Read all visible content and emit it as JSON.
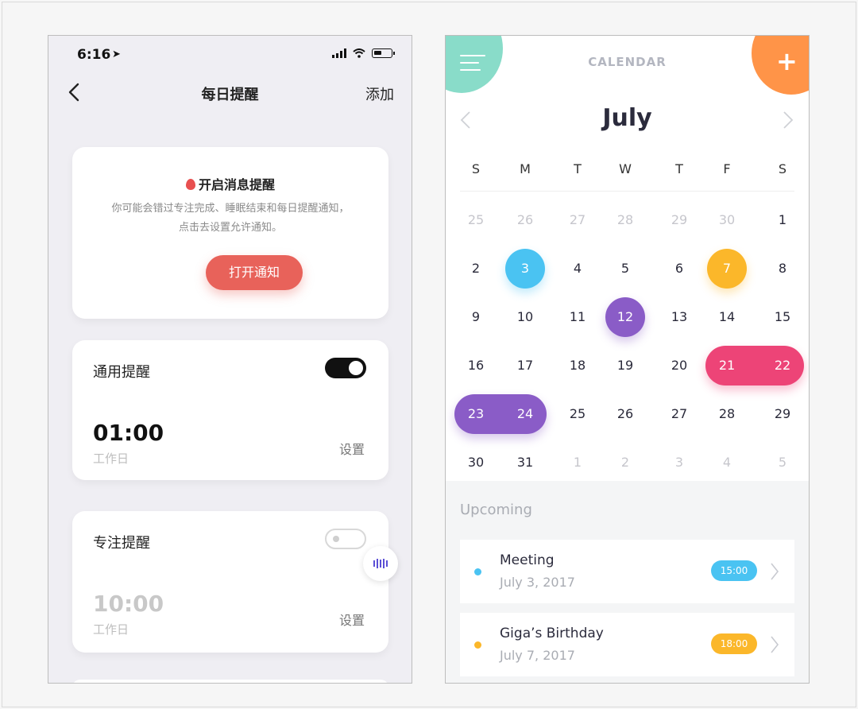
{
  "left_app": {
    "status": {
      "time": "6:16",
      "location_glyph": "➤"
    },
    "nav": {
      "title": "每日提醒",
      "action": "添加"
    },
    "notify_card": {
      "title": "开启消息提醒",
      "desc_line1": "你可能会错过专注完成、睡眠结束和每日提醒通知，",
      "desc_line2": "点击去设置允许通知。",
      "button": "打开通知"
    },
    "general_reminder": {
      "label": "通用提醒",
      "enabled": true,
      "time": "01:00",
      "days": "工作日",
      "settings": "设置"
    },
    "focus_reminder": {
      "label": "专注提醒",
      "enabled": false,
      "time": "10:00",
      "days": "工作日",
      "settings": "设置"
    }
  },
  "right_app": {
    "header": "CALENDAR",
    "month": "July",
    "weekdays": [
      "S",
      "M",
      "T",
      "W",
      "T",
      "F",
      "S"
    ],
    "weeks": [
      [
        "25",
        "26",
        "27",
        "28",
        "29",
        "30",
        "1"
      ],
      [
        "2",
        "3",
        "4",
        "5",
        "6",
        "7",
        "8"
      ],
      [
        "9",
        "10",
        "11",
        "12",
        "13",
        "14",
        "15"
      ],
      [
        "16",
        "17",
        "18",
        "19",
        "20",
        "21",
        "22"
      ],
      [
        "23",
        "24",
        "25",
        "26",
        "27",
        "28",
        "29"
      ],
      [
        "30",
        "31",
        "1",
        "2",
        "3",
        "4",
        "5"
      ]
    ],
    "upcoming_title": "Upcoming",
    "events": [
      {
        "title": "Meeting",
        "date": "July 3, 2017",
        "time": "15:00",
        "color": "#4ac3f2"
      },
      {
        "title": "Giga’s Birthday",
        "date": "July 7, 2017",
        "time": "18:00",
        "color": "#fbb72a"
      }
    ]
  },
  "colors": {
    "accent_red": "#e8625a",
    "menu_teal": "#89dcc9",
    "add_orange": "#ff9448",
    "blue": "#4ac3f2",
    "yellow": "#fbb72a",
    "purple": "#8a5cc7",
    "pink": "#ed4477"
  }
}
